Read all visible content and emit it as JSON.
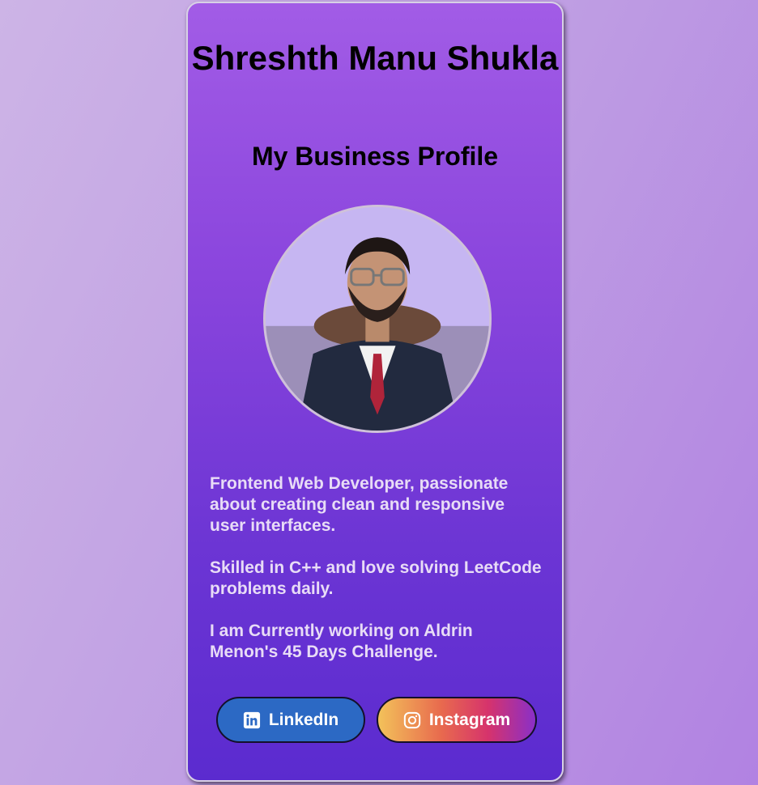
{
  "profile": {
    "name": "Shreshth Manu Shukla",
    "subtitle": "My Business Profile",
    "photo_alt": "Profile photo"
  },
  "bio": {
    "para1": "Frontend Web Developer, passionate about creating clean and responsive user interfaces.",
    "para2": "Skilled in C++ and love solving LeetCode problems daily.",
    "para3": "I am Currently working on Aldrin Menon's 45 Days Challenge."
  },
  "buttons": {
    "linkedin_label": "LinkedIn",
    "instagram_label": "Instagram",
    "linkedin_icon": "linkedin-icon",
    "instagram_icon": "instagram-icon"
  },
  "colors": {
    "card_top": "#a25ce6",
    "card_bottom": "#5b2bcf",
    "linkedin": "#2c69c4",
    "bio_text": "#e8dcf6"
  }
}
